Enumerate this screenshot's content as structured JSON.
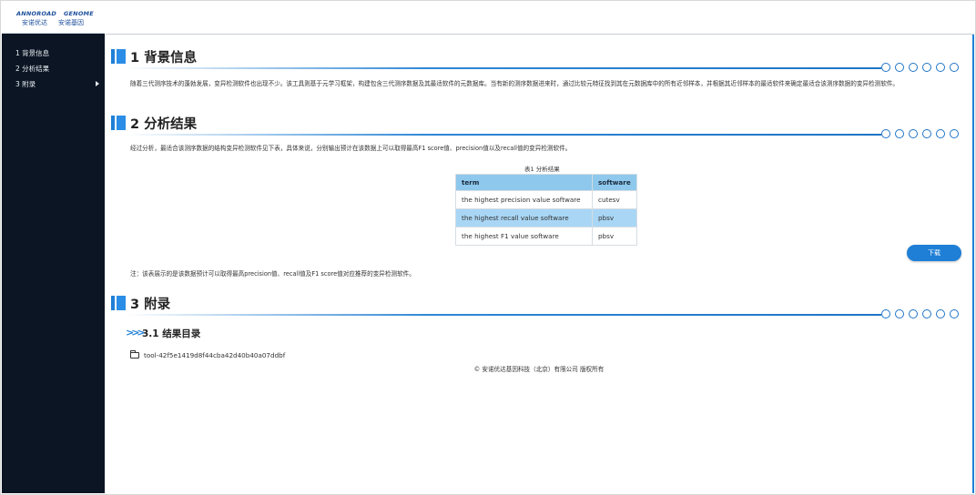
{
  "logo": {
    "en_left": "ANNOROAD",
    "en_right": "GENOME",
    "cn_left": "安诺优达",
    "cn_right": "安诺基因"
  },
  "sidebar": {
    "items": [
      {
        "label": "1 背景信息"
      },
      {
        "label": "2 分析结果"
      },
      {
        "label": "3 附录"
      }
    ]
  },
  "colors": {
    "accent": "#1f7fd6",
    "sidebar_bg": "#0b1523",
    "table_header": "#8ec8ec",
    "table_highlight": "#a9d6f5"
  },
  "sections": {
    "background": {
      "title": "1 背景信息",
      "text": "随着三代测序技术的蓬勃发展，变异检测软件也出现不少。该工具则基于元学习框架，构建包含三代测序数据及其最适软件的元数据库。当有新的测序数据进来时，通过比较元特征找到其在元数据库中的所有近邻样本，并根据其近邻样本的最适软件来确定最适合该测序数据的变异检测软件。"
    },
    "results": {
      "title": "2 分析结果",
      "text": "经过分析，最适合该测序数据的结构变异检测软件见下表，具体来说，分别输出预计在该数据上可以取得最高F1 score值、precision值以及recall值的变异检测软件。",
      "table": {
        "caption": "表1 分析结果",
        "headers": {
          "term": "term",
          "software": "software"
        },
        "rows": [
          {
            "term": "the highest precision value software",
            "software": "cutesv"
          },
          {
            "term": "the highest recall value software",
            "software": "pbsv"
          },
          {
            "term": "the highest F1 value software",
            "software": "pbsv"
          }
        ]
      },
      "download_label": "下载",
      "note": "注：该表展示的是该数据预计可以取得最高precision值、recall值及F1 score值对应推荐的变异检测软件。"
    },
    "appendix": {
      "title": "3 附录",
      "subsection_title": "3.1 结果目录",
      "folder": "tool-42f5e1419d8f44cba42d40b40a07ddbf"
    }
  },
  "footer": "© 安诺优达基因科技（北京）有限公司 版权所有"
}
